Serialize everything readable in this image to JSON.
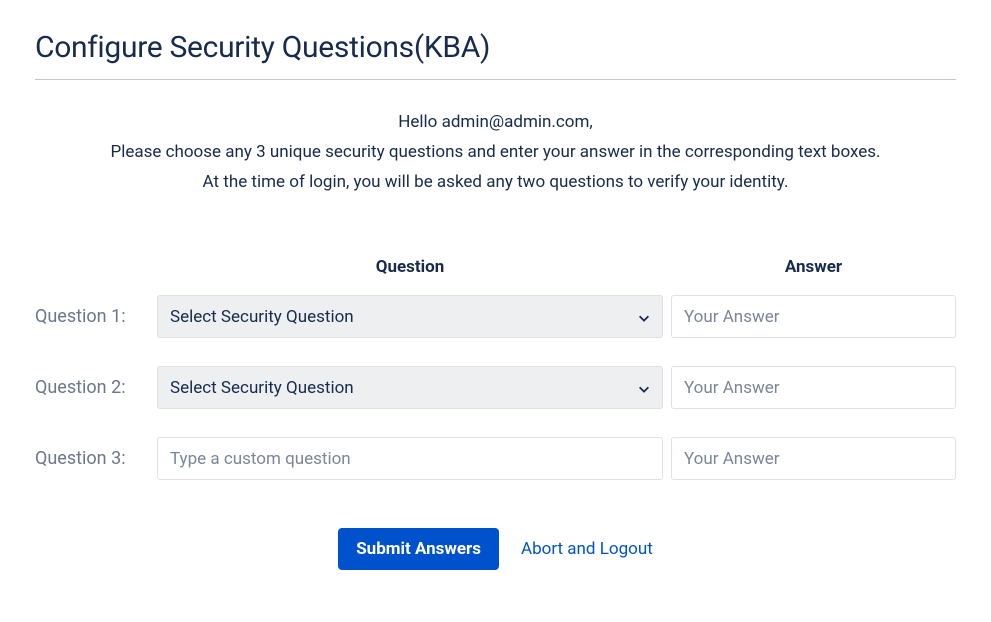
{
  "title": "Configure Security Questions(KBA)",
  "intro": {
    "greeting": "Hello admin@admin.com,",
    "line1": "Please choose any 3 unique security questions and enter your answer in the corresponding text boxes.",
    "line2": "At the time of login, you will be asked any two questions to verify your identity."
  },
  "headers": {
    "question": "Question",
    "answer": "Answer"
  },
  "rows": [
    {
      "label": "Question 1:",
      "type": "select",
      "question_placeholder": "Select Security Question",
      "answer_placeholder": "Your Answer"
    },
    {
      "label": "Question 2:",
      "type": "select",
      "question_placeholder": "Select Security Question",
      "answer_placeholder": "Your Answer"
    },
    {
      "label": "Question 3:",
      "type": "text",
      "question_placeholder": "Type a custom question",
      "answer_placeholder": "Your Answer"
    }
  ],
  "actions": {
    "submit": "Submit Answers",
    "abort": "Abort and Logout"
  }
}
